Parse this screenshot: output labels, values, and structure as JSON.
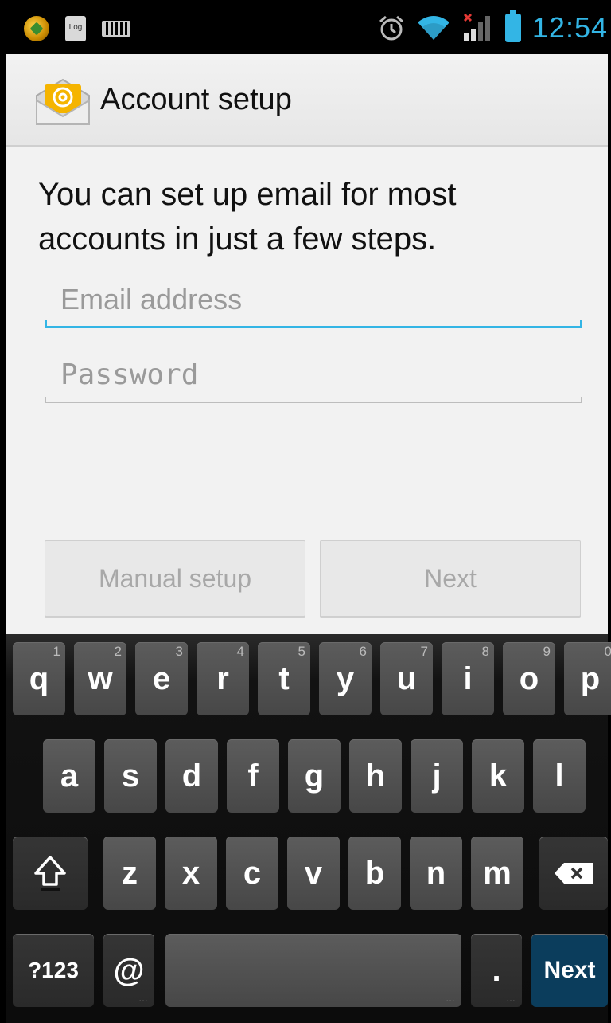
{
  "status_bar": {
    "time": "12:54",
    "icons": [
      "gold-app-icon",
      "log-icon",
      "keyboard-icon",
      "alarm-icon",
      "wifi-icon",
      "signal-icon",
      "battery-icon"
    ],
    "log_icon_text": "Log",
    "accent_color": "#33b5e5"
  },
  "action_bar": {
    "title": "Account setup",
    "icon": "email-icon"
  },
  "form": {
    "intro": "You can set up email for most accounts in just a few steps.",
    "email": {
      "placeholder": "Email address",
      "value": ""
    },
    "password": {
      "placeholder": "Password",
      "value": ""
    },
    "manual_setup_label": "Manual setup",
    "next_label": "Next"
  },
  "keyboard": {
    "row1": [
      {
        "label": "q",
        "hint": "1"
      },
      {
        "label": "w",
        "hint": "2"
      },
      {
        "label": "e",
        "hint": "3"
      },
      {
        "label": "r",
        "hint": "4"
      },
      {
        "label": "t",
        "hint": "5"
      },
      {
        "label": "y",
        "hint": "6"
      },
      {
        "label": "u",
        "hint": "7"
      },
      {
        "label": "i",
        "hint": "8"
      },
      {
        "label": "o",
        "hint": "9"
      },
      {
        "label": "p",
        "hint": "0"
      }
    ],
    "row2": [
      "a",
      "s",
      "d",
      "f",
      "g",
      "h",
      "j",
      "k",
      "l"
    ],
    "row3": [
      "z",
      "x",
      "c",
      "v",
      "b",
      "n",
      "m"
    ],
    "symbols_label": "?123",
    "at_label": "@",
    "period_label": ".",
    "next_label": "Next",
    "shift_icon": "shift-icon",
    "backspace_icon": "backspace-icon"
  }
}
